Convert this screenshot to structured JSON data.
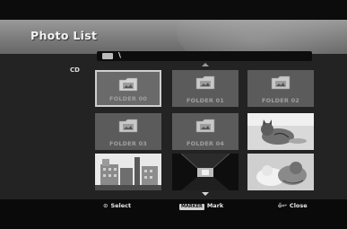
{
  "title": "Photo List",
  "sidebar": {
    "label": "CD"
  },
  "path": {
    "text": "\\"
  },
  "folders": [
    {
      "label": "FOLDER 00",
      "selected": true
    },
    {
      "label": "FOLDER 01",
      "selected": false
    },
    {
      "label": "FOLDER 02",
      "selected": false
    },
    {
      "label": "FOLDER 03",
      "selected": false
    },
    {
      "label": "FOLDER 04",
      "selected": false
    }
  ],
  "footer": {
    "select_icon": "⊙",
    "select_label": "Select",
    "marker_badge": "MARKER",
    "mark_label": "Mark",
    "close_icon": "ő↩",
    "close_label": "Close"
  },
  "photos": [
    {
      "name": "photo-kitten"
    },
    {
      "name": "photo-building"
    },
    {
      "name": "photo-tunnel"
    },
    {
      "name": "photo-cats"
    }
  ]
}
